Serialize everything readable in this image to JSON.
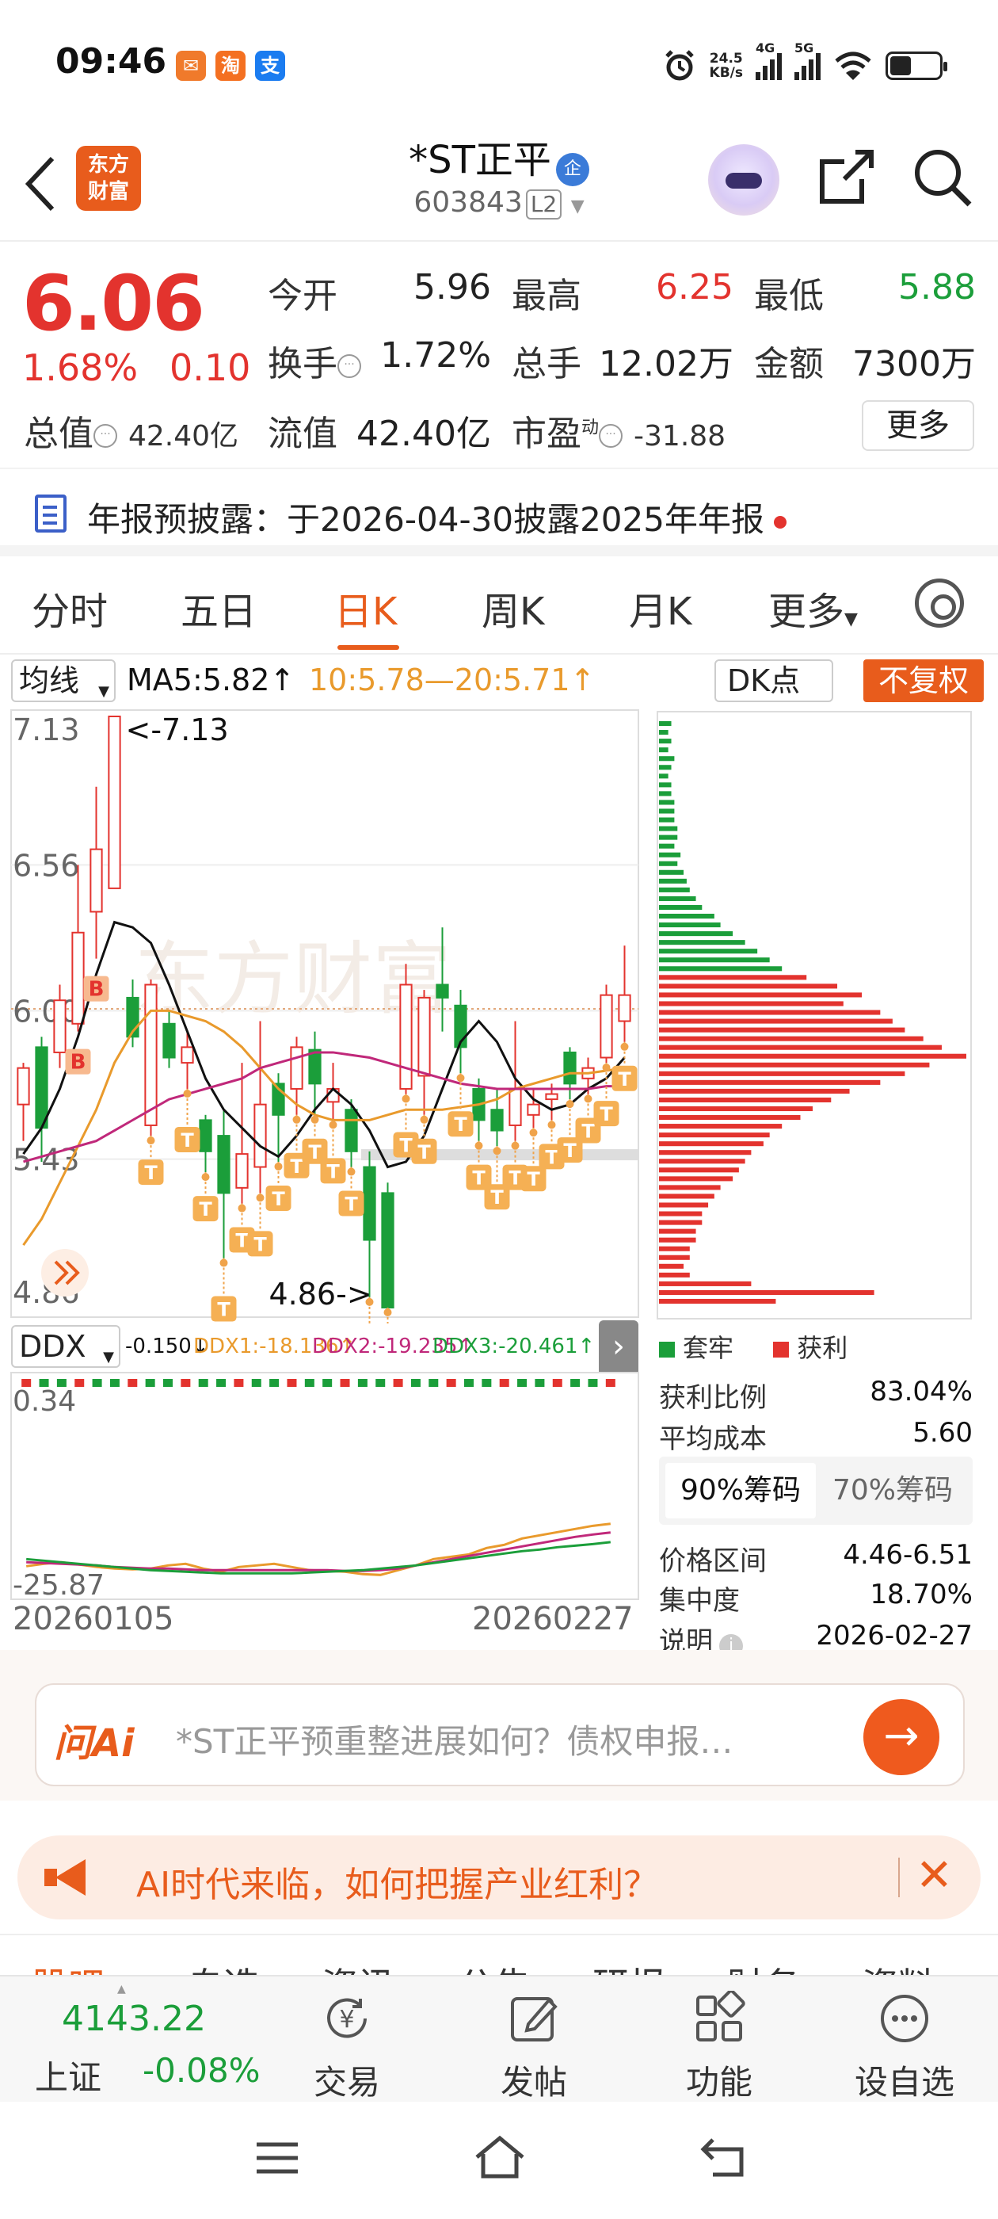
{
  "status_bar": {
    "time": "09:46",
    "net_speed_value": "24.5",
    "net_speed_unit": "KB/s",
    "sig1_label": "4G",
    "sig2_label": "5G",
    "app_icons": [
      "taobao-fish",
      "taobao",
      "alipay"
    ],
    "app_icon_glyphs": [
      "✉",
      "淘",
      "支"
    ]
  },
  "header": {
    "logo_line1": "东方",
    "logo_line2": "财富",
    "stock_name": "*ST正平",
    "badge": "企",
    "stock_code": "603843",
    "level": "L2"
  },
  "quote": {
    "price": "6.06",
    "change_pct": "1.68%",
    "change_abs": "0.10",
    "open_label": "今开",
    "open": "5.96",
    "high_label": "最高",
    "high": "6.25",
    "low_label": "最低",
    "low": "5.88",
    "turnover_label": "换手",
    "turnover": "1.72%",
    "volume_label": "总手",
    "volume": "12.02万",
    "amount_label": "金额",
    "amount": "7300万",
    "mktcap_label": "总值",
    "mktcap": "42.40亿",
    "float_label": "流值",
    "float_cap": "42.40亿",
    "pe_label": "市盈",
    "pe_super": "动",
    "pe": "-31.88",
    "more_button": "更多"
  },
  "notice": {
    "text": "年报预披露：于2026-04-30披露2025年年报"
  },
  "tabs": [
    "分时",
    "五日",
    "日K",
    "周K",
    "月K",
    "更多"
  ],
  "active_tab": "日K",
  "chart_bar": {
    "ma_select": "均线",
    "ma5": "MA5:5.82",
    "ma10_20": "10:5.78—20:5.71",
    "dk_button": "DK点",
    "adjust_button": "不复权"
  },
  "chart_data": [
    {
      "type": "candlestick",
      "ylim": [
        4.86,
        7.13
      ],
      "y_ticks": [
        "7.13",
        "6.56",
        "6.00",
        "5.43",
        "4.86"
      ],
      "max_marker": "<-7.13",
      "min_marker": "4.86->",
      "watermark": "东方财富",
      "x_range": [
        "20260105",
        "20260227"
      ],
      "candles": [
        {
          "o": 5.64,
          "c": 5.78,
          "h": 5.8,
          "l": 5.5
        },
        {
          "o": 5.86,
          "c": 5.55,
          "h": 5.9,
          "l": 5.42
        },
        {
          "o": 5.84,
          "c": 6.04,
          "h": 6.1,
          "l": 5.78
        },
        {
          "o": 5.95,
          "c": 6.3,
          "h": 6.56,
          "l": 5.92
        },
        {
          "o": 6.38,
          "c": 6.62,
          "h": 6.86,
          "l": 6.2
        },
        {
          "o": 6.47,
          "c": 7.13,
          "h": 7.13,
          "l": 6.47
        },
        {
          "o": 6.05,
          "c": 5.9,
          "h": 6.12,
          "l": 5.86
        },
        {
          "o": 5.56,
          "c": 6.1,
          "h": 6.12,
          "l": 5.52
        },
        {
          "o": 5.95,
          "c": 5.82,
          "h": 6.0,
          "l": 5.78
        },
        {
          "o": 5.8,
          "c": 5.86,
          "h": 5.92,
          "l": 5.7
        },
        {
          "o": 5.58,
          "c": 5.46,
          "h": 5.6,
          "l": 5.38
        },
        {
          "o": 5.52,
          "c": 5.3,
          "h": 5.62,
          "l": 5.05
        },
        {
          "o": 5.32,
          "c": 5.45,
          "h": 5.8,
          "l": 5.26
        },
        {
          "o": 5.4,
          "c": 5.64,
          "h": 5.96,
          "l": 5.3
        },
        {
          "o": 5.72,
          "c": 5.6,
          "h": 5.76,
          "l": 5.42
        },
        {
          "o": 5.7,
          "c": 5.86,
          "h": 5.9,
          "l": 5.6
        },
        {
          "o": 5.85,
          "c": 5.72,
          "h": 5.92,
          "l": 5.6
        },
        {
          "o": 5.65,
          "c": 5.7,
          "h": 5.8,
          "l": 5.58
        },
        {
          "o": 5.62,
          "c": 5.46,
          "h": 5.66,
          "l": 5.4
        },
        {
          "o": 5.4,
          "c": 5.12,
          "h": 5.46,
          "l": 4.9
        },
        {
          "o": 5.3,
          "c": 4.86,
          "h": 5.34,
          "l": 4.86
        },
        {
          "o": 5.7,
          "c": 6.1,
          "h": 6.18,
          "l": 5.68
        },
        {
          "o": 5.75,
          "c": 6.05,
          "h": 6.08,
          "l": 5.6
        },
        {
          "o": 6.1,
          "c": 6.05,
          "h": 6.32,
          "l": 5.92
        },
        {
          "o": 6.02,
          "c": 5.86,
          "h": 6.08,
          "l": 5.76
        },
        {
          "o": 5.7,
          "c": 5.58,
          "h": 5.74,
          "l": 5.5
        },
        {
          "o": 5.62,
          "c": 5.54,
          "h": 5.7,
          "l": 5.48
        },
        {
          "o": 5.56,
          "c": 5.7,
          "h": 5.96,
          "l": 5.5
        },
        {
          "o": 5.6,
          "c": 5.64,
          "h": 5.7,
          "l": 5.55
        },
        {
          "o": 5.66,
          "c": 5.68,
          "h": 5.72,
          "l": 5.58
        },
        {
          "o": 5.84,
          "c": 5.72,
          "h": 5.86,
          "l": 5.66
        },
        {
          "o": 5.74,
          "c": 5.78,
          "h": 5.82,
          "l": 5.68
        },
        {
          "o": 5.82,
          "c": 6.06,
          "h": 6.1,
          "l": 5.8
        },
        {
          "o": 5.96,
          "c": 6.06,
          "h": 6.25,
          "l": 5.88
        }
      ],
      "ma_series": [
        {
          "name": "MA5",
          "color": "#111111",
          "values": [
            5.45,
            5.55,
            5.7,
            5.9,
            6.14,
            6.34,
            6.32,
            6.26,
            6.1,
            5.92,
            5.74,
            5.62,
            5.55,
            5.48,
            5.44,
            5.52,
            5.62,
            5.7,
            5.64,
            5.54,
            5.4,
            5.42,
            5.52,
            5.7,
            5.88,
            5.96,
            5.88,
            5.74,
            5.66,
            5.62,
            5.64,
            5.7,
            5.74,
            5.82
          ]
        },
        {
          "name": "MA10",
          "color": "#e99a2c",
          "values": [
            5.1,
            5.2,
            5.34,
            5.48,
            5.62,
            5.8,
            5.92,
            6.0,
            6.0,
            5.98,
            5.96,
            5.92,
            5.86,
            5.78,
            5.7,
            5.64,
            5.6,
            5.58,
            5.58,
            5.58,
            5.6,
            5.62,
            5.62,
            5.62,
            5.63,
            5.64,
            5.66,
            5.7,
            5.72,
            5.74,
            5.76,
            5.76,
            5.77,
            5.78
          ]
        },
        {
          "name": "MA20",
          "color": "#c0287a",
          "values": [
            5.42,
            5.44,
            5.46,
            5.48,
            5.5,
            5.54,
            5.58,
            5.62,
            5.66,
            5.68,
            5.7,
            5.72,
            5.74,
            5.78,
            5.8,
            5.82,
            5.84,
            5.84,
            5.83,
            5.82,
            5.8,
            5.78,
            5.76,
            5.74,
            5.72,
            5.71,
            5.7,
            5.7,
            5.7,
            5.7,
            5.7,
            5.7,
            5.71,
            5.71
          ]
        }
      ],
      "signals": {
        "B": [
          3,
          4
        ],
        "T": [
          7,
          9,
          10,
          11,
          12,
          13,
          14,
          15,
          16,
          17,
          18,
          19,
          20,
          21,
          22,
          24,
          25,
          26,
          27,
          28,
          29,
          30,
          31,
          32,
          33
        ]
      }
    },
    {
      "type": "line",
      "title": "DDX",
      "ylim": [
        -25.87,
        0.34
      ],
      "y_ticks": [
        "0.34",
        "-25.87"
      ],
      "series": [
        {
          "name": "DDX1",
          "color": "#e99a2c",
          "values": [
            -23.5,
            -23.2,
            -23.0,
            -23.3,
            -23.6,
            -23.8,
            -23.9,
            -23.8,
            -23.4,
            -23.2,
            -23.8,
            -24.2,
            -23.6,
            -23.4,
            -23.2,
            -23.6,
            -24.0,
            -24.1,
            -24.2,
            -24.5,
            -24.6,
            -24.0,
            -23.4,
            -22.6,
            -22.3,
            -22.0,
            -21.2,
            -20.8,
            -20.0,
            -19.6,
            -19.2,
            -18.8,
            -18.4,
            -18.14
          ]
        },
        {
          "name": "DDX2",
          "color": "#c0287a",
          "values": [
            -23.0,
            -23.1,
            -23.2,
            -23.3,
            -23.4,
            -23.6,
            -23.7,
            -23.8,
            -23.8,
            -23.9,
            -24.0,
            -24.0,
            -24.0,
            -24.0,
            -24.0,
            -24.0,
            -24.0,
            -24.0,
            -24.1,
            -24.1,
            -24.0,
            -23.8,
            -23.4,
            -23.0,
            -22.6,
            -22.2,
            -21.8,
            -21.4,
            -21.0,
            -20.6,
            -20.2,
            -19.8,
            -19.5,
            -19.24
          ]
        },
        {
          "name": "DDX3",
          "color": "#1b9e3a",
          "values": [
            -22.6,
            -22.8,
            -23.0,
            -23.2,
            -23.4,
            -23.6,
            -23.8,
            -24.0,
            -24.1,
            -24.2,
            -24.3,
            -24.4,
            -24.4,
            -24.4,
            -24.4,
            -24.4,
            -24.3,
            -24.2,
            -24.1,
            -24.0,
            -23.8,
            -23.6,
            -23.4,
            -23.1,
            -22.8,
            -22.5,
            -22.2,
            -21.9,
            -21.6,
            -21.4,
            -21.1,
            -20.9,
            -20.7,
            -20.46
          ]
        }
      ]
    },
    {
      "type": "bar",
      "title": "chip-distribution",
      "orientation": "horizontal",
      "legend": [
        {
          "name": "套牢",
          "color": "#1b9e3a"
        },
        {
          "name": "获利",
          "color": "#e3332e"
        }
      ],
      "green_rows": [
        0.04,
        0.03,
        0.04,
        0.03,
        0.05,
        0.04,
        0.03,
        0.04,
        0.04,
        0.05,
        0.05,
        0.05,
        0.06,
        0.06,
        0.05,
        0.07,
        0.06,
        0.08,
        0.09,
        0.1,
        0.12,
        0.14,
        0.18,
        0.2,
        0.24,
        0.28,
        0.32,
        0.36,
        0.4
      ],
      "red_rows": [
        0.48,
        0.58,
        0.66,
        0.6,
        0.72,
        0.76,
        0.8,
        0.86,
        0.92,
        1.0,
        0.88,
        0.8,
        0.72,
        0.62,
        0.56,
        0.5,
        0.46,
        0.4,
        0.36,
        0.34,
        0.3,
        0.28,
        0.26,
        0.24,
        0.2,
        0.18,
        0.16,
        0.14,
        0.14,
        0.12,
        0.12,
        0.1,
        0.1,
        0.08,
        0.1,
        0.3,
        0.7,
        0.38
      ]
    }
  ],
  "ddx_bar": {
    "select": "DDX",
    "ddx": "-0.150",
    "ddx1": "DDX1:-18.136",
    "ddx2": "DDX2:-19.235",
    "ddx3": "DDX3:-20.461",
    "dates": [
      "20260105",
      "20260227"
    ]
  },
  "chip_stats": {
    "legend_trapped": "套牢",
    "legend_profit": "获利",
    "profit_ratio_label": "获利比例",
    "profit_ratio": "83.04%",
    "avg_cost_label": "平均成本",
    "avg_cost": "5.60",
    "tab90": "90%筹码",
    "tab70": "70%筹码",
    "range_label": "价格区间",
    "range": "4.46-6.51",
    "conc_label": "集中度",
    "concentration": "18.70%",
    "note_label": "说明",
    "date": "2026-02-27"
  },
  "ai": {
    "logo": "问Ai",
    "placeholder": "*ST正平预重整进展如何？债权申报…"
  },
  "banner": {
    "text": "AI时代来临，如何把握产业红利？"
  },
  "sub_nav": [
    "股吧",
    "自选",
    "资讯",
    "公告",
    "研报",
    "财务",
    "资料"
  ],
  "bottom_nav": {
    "index_value": "4143.22",
    "index_name": "上证",
    "index_change": "-0.08%",
    "items": [
      "交易",
      "发帖",
      "功能",
      "设自选"
    ]
  }
}
